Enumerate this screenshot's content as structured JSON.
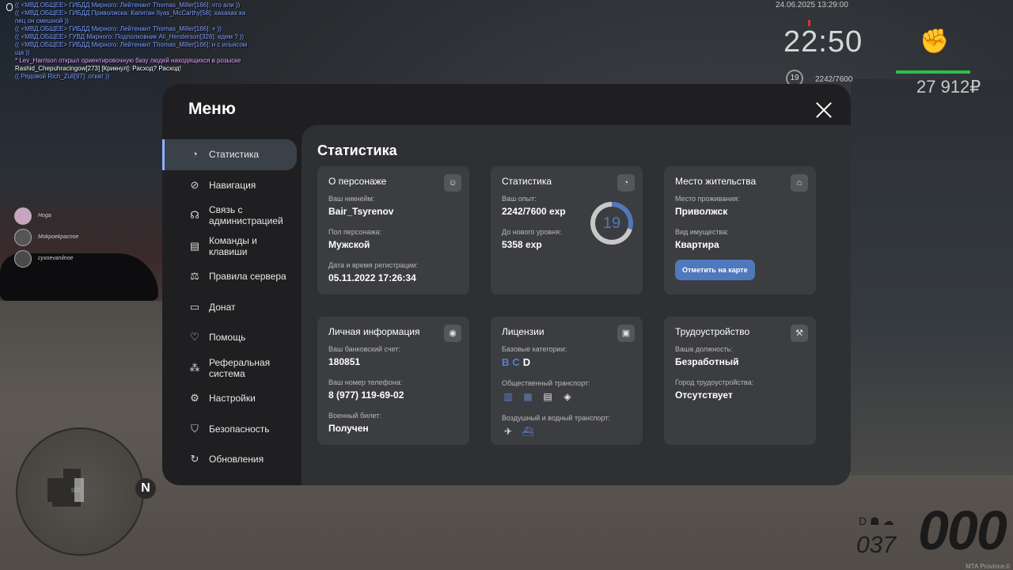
{
  "hud": {
    "chat": [
      {
        "text": "(( <МВД.ОБЩЕЕ> ГИБДД Мирного: Лейтенант Thomas_Miller[166]: что али ))",
        "color": "blue"
      },
      {
        "text": "(( <МВД.ОБЩЕЕ> ГИБДД Приволжска: Капитан Ilyas_McCarthy[58]: хахахах ка",
        "color": "blue"
      },
      {
        "text": "пец он смешной ))",
        "color": "blue"
      },
      {
        "text": "(( <МВД.ОБЩЕЕ> ГИБДД Мирного: Лейтенант Thomas_Miller[166]: + ))",
        "color": "blue"
      },
      {
        "text": "(( <МВД.ОБЩЕЕ> ГУВД Мирного: Подполковник Ali_Henderson[326]: едем ? ))",
        "color": "blue"
      },
      {
        "text": "(( <МВД.ОБЩЕЕ> ГИБДД Мирного: Лейтенант Thomas_Miller[166]: н с ильясом",
        "color": "blue"
      },
      {
        "text": "ща ))",
        "color": "blue"
      },
      {
        "text": "* Lev_Harrison открыл ориентировочную базу людей находящихся в розыске",
        "color": "pink"
      },
      {
        "text": "Rashid_Chepuhracingow[273] [Крикнул]: Расход? Расход!",
        "color": "white"
      },
      {
        "text": "(( Рядовой Rich_Zull[97]: откат ))",
        "color": "blue"
      }
    ],
    "voices": [
      "Hoga",
      "Mokpoekpacnoe",
      "cyxoevanilnoe"
    ],
    "datetime": "24.06.2025 13:29:00",
    "clock": "22:50",
    "level": "19",
    "exp": "2242/7600",
    "money": "27 912₽",
    "fist_icon": "fist-icon",
    "speed": "000",
    "fuel": "037",
    "gear": "D",
    "north": "N",
    "watermark": "MTA Province.0"
  },
  "menu": {
    "title": "Меню",
    "nav": [
      {
        "label": "Статистика",
        "icon": "◔",
        "active": true
      },
      {
        "label": "Навигация",
        "icon": "⊘"
      },
      {
        "label": "Связь с администрацией",
        "icon": "☊"
      },
      {
        "label": "Команды и клавиши",
        "icon": "▤"
      },
      {
        "label": "Правила сервера",
        "icon": "⚖"
      },
      {
        "label": "Донат",
        "icon": "▭"
      },
      {
        "label": "Помощь",
        "icon": "♡"
      },
      {
        "label": "Реферальная система",
        "icon": "⁂"
      },
      {
        "label": "Настройки",
        "icon": "⚙"
      },
      {
        "label": "Безопасность",
        "icon": "⛉"
      },
      {
        "label": "Обновления",
        "icon": "↻"
      }
    ],
    "content_title": "Статистика",
    "cards": {
      "character": {
        "title": "О персонаже",
        "nick_label": "Ваш никнейм:",
        "nick": "Bair_Tsyrenov",
        "gender_label": "Пол персонажа:",
        "gender": "Мужской",
        "reg_label": "Дата и время регистрации:",
        "reg": "05.11.2022 17:26:34"
      },
      "stats": {
        "title": "Статистика",
        "exp_label": "Ваш опыт:",
        "exp": "2242/7600 exp",
        "next_label": "До нового уровня:",
        "next": "5358 exp",
        "level": "19",
        "progress": 0.295
      },
      "residence": {
        "title": "Место жительства",
        "place_label": "Место проживания:",
        "place": "Приволжск",
        "prop_label": "Вид имущества:",
        "prop": "Квартира",
        "button": "Отметить на карте"
      },
      "personal": {
        "title": "Личная информация",
        "bank_label": "Ваш банковский счет:",
        "bank": "180851",
        "phone_label": "Ваш номер телефона:",
        "phone": "8 (977) 119-69-02",
        "military_label": "Военный билет:",
        "military": "Получен"
      },
      "licenses": {
        "title": "Лицензии",
        "base_label": "Базовые категории:",
        "categories": [
          {
            "c": "B",
            "has": false
          },
          {
            "c": "C",
            "has": false
          },
          {
            "c": "D",
            "has": true
          }
        ],
        "public_label": "Общественный транспорт:",
        "air_label": "Воздушный и водный транспорт:"
      },
      "job": {
        "title": "Трудоустройство",
        "pos_label": "Ваша должность:",
        "pos": "Безработный",
        "city_label": "Город трудоустройства:",
        "city": "Отсутствует"
      }
    }
  }
}
